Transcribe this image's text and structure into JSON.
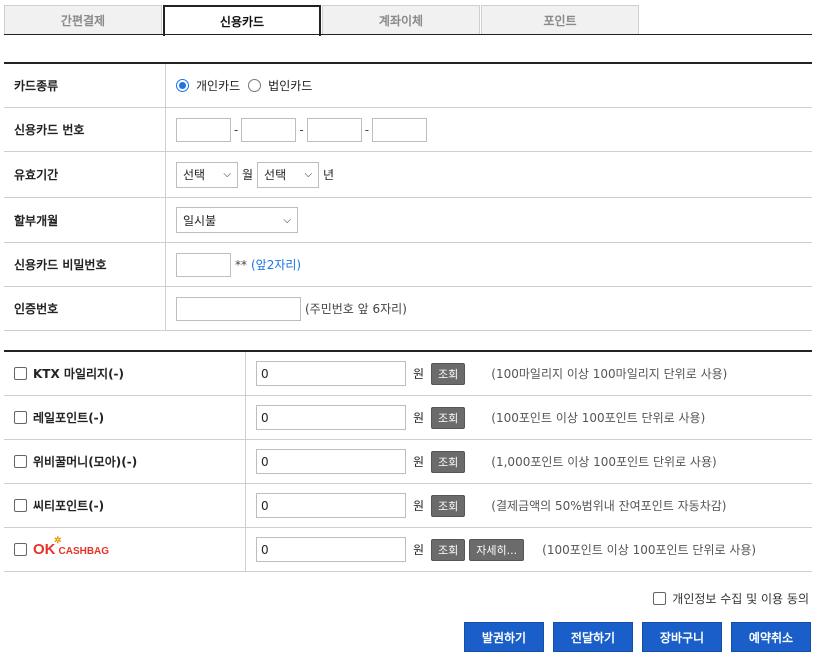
{
  "tabs": [
    {
      "label": "간편결제",
      "active": false
    },
    {
      "label": "신용카드",
      "active": true
    },
    {
      "label": "계좌이체",
      "active": false
    },
    {
      "label": "포인트",
      "active": false
    }
  ],
  "form": {
    "card_type": {
      "label": "카드종류",
      "options": [
        "개인카드",
        "법인카드"
      ],
      "selected": "개인카드"
    },
    "card_number": {
      "label": "신용카드 번호",
      "separator": "-"
    },
    "expiry": {
      "label": "유효기간",
      "month_value": "선택",
      "month_unit": "월",
      "year_value": "선택",
      "year_unit": "년"
    },
    "installment": {
      "label": "할부개월",
      "value": "일시불"
    },
    "password": {
      "label": "신용카드 비밀번호",
      "mask": "**",
      "hint": "(앞2자리)"
    },
    "auth": {
      "label": "인증번호",
      "hint": "(주민번호 앞 6자리)"
    }
  },
  "points": {
    "won_label": "원",
    "lookup_label": "조회",
    "detail_label": "자세히...",
    "rows": [
      {
        "label": "KTX 마일리지(-)",
        "value": "0",
        "note": "(100마일리지 이상 100마일리지 단위로 사용)"
      },
      {
        "label": "레일포인트(-)",
        "value": "0",
        "note": "(100포인트 이상 100포인트 단위로 사용)"
      },
      {
        "label": "위비꿀머니(모아)(-)",
        "value": "0",
        "note": "(1,000포인트 이상 100포인트 단위로 사용)"
      },
      {
        "label": "씨티포인트(-)",
        "value": "0",
        "note": "(결제금액의 50%범위내 잔여포인트 자동차감)"
      },
      {
        "label": "",
        "value": "0",
        "note": "(100포인트 이상 100포인트 단위로 사용)"
      }
    ],
    "okcashbag": {
      "ok": "OK",
      "cashbag": "CASHBAG"
    }
  },
  "consent_label": "개인정보 수집 및 이용 동의",
  "actions": [
    "발권하기",
    "전달하기",
    "장바구니",
    "예약취소"
  ]
}
